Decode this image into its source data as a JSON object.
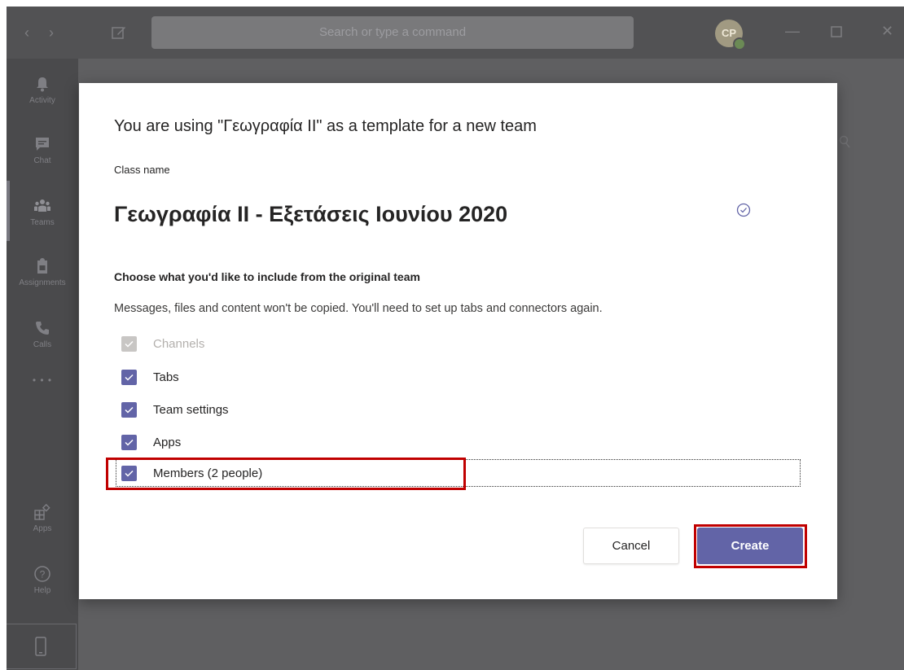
{
  "titlebar": {
    "search_placeholder": "Search or type a command",
    "avatar_initials": "CP"
  },
  "rail": {
    "items": [
      {
        "label": "Activity",
        "icon": "bell-icon"
      },
      {
        "label": "Chat",
        "icon": "chat-icon"
      },
      {
        "label": "Teams",
        "icon": "teams-icon"
      },
      {
        "label": "Assignments",
        "icon": "assignments-icon"
      },
      {
        "label": "Calls",
        "icon": "phone-icon"
      },
      {
        "label": "Apps",
        "icon": "apps-icon"
      },
      {
        "label": "Help",
        "icon": "help-icon"
      }
    ],
    "more": "• • •"
  },
  "dialog": {
    "title": "You are using \"Γεωγραφία ΙΙ\" as a template for a new team",
    "class_name_label": "Class name",
    "class_name_value": "Γεωγραφία ΙΙ - Εξετάσεις Ιουνίου 2020",
    "include_heading": "Choose what you'd like to include from the original team",
    "note": "Messages, files and content won't be copied. You'll need to set up tabs and connectors again.",
    "options": [
      {
        "label": "Channels",
        "checked": true,
        "disabled": true
      },
      {
        "label": "Tabs",
        "checked": true,
        "disabled": false
      },
      {
        "label": "Team settings",
        "checked": true,
        "disabled": false
      },
      {
        "label": "Apps",
        "checked": true,
        "disabled": false
      },
      {
        "label": "Members (2 people)",
        "checked": true,
        "disabled": false
      }
    ],
    "cancel_label": "Cancel",
    "create_label": "Create"
  },
  "colors": {
    "accent": "#6264a7",
    "highlight": "#c00000"
  }
}
